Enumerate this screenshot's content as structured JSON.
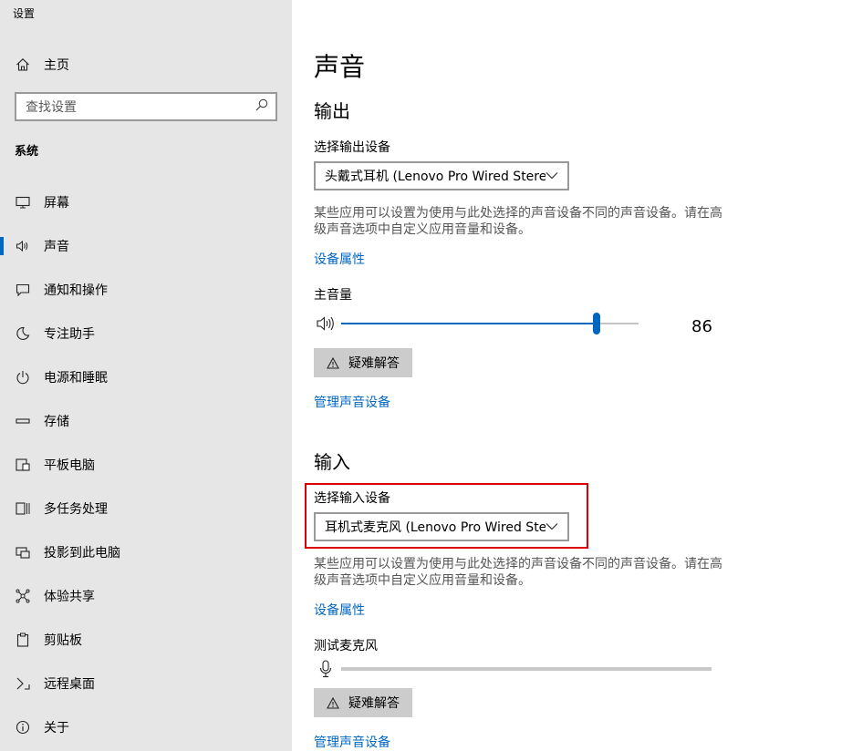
{
  "app": {
    "title": "设置"
  },
  "sidebar": {
    "home_label": "主页",
    "search_placeholder": "查找设置",
    "section": "系统",
    "items": [
      {
        "label": "屏幕",
        "icon": "display-icon"
      },
      {
        "label": "声音",
        "icon": "speaker-icon",
        "active": true
      },
      {
        "label": "通知和操作",
        "icon": "notification-icon"
      },
      {
        "label": "专注助手",
        "icon": "moon-icon"
      },
      {
        "label": "电源和睡眠",
        "icon": "power-icon"
      },
      {
        "label": "存储",
        "icon": "storage-icon"
      },
      {
        "label": "平板电脑",
        "icon": "tablet-icon"
      },
      {
        "label": "多任务处理",
        "icon": "multitask-icon"
      },
      {
        "label": "投影到此电脑",
        "icon": "project-icon"
      },
      {
        "label": "体验共享",
        "icon": "share-icon"
      },
      {
        "label": "剪贴板",
        "icon": "clipboard-icon"
      },
      {
        "label": "远程桌面",
        "icon": "remote-desktop-icon"
      },
      {
        "label": "关于",
        "icon": "info-icon"
      }
    ]
  },
  "main": {
    "title": "声音",
    "output": {
      "heading": "输出",
      "device_label": "选择输出设备",
      "device_value": "头戴式耳机 (Lenovo Pro Wired Stere...",
      "description": "某些应用可以设置为使用与此处选择的声音设备不同的声音设备。请在高级声音选项中自定义应用音量和设备。",
      "properties_link": "设备属性",
      "volume_label": "主音量",
      "volume_value": "86",
      "volume_level": 86,
      "troubleshoot": "疑难解答",
      "manage_link": "管理声音设备"
    },
    "input": {
      "heading": "输入",
      "device_label": "选择输入设备",
      "device_value": "耳机式麦克风 (Lenovo Pro Wired Ste...",
      "description": "某些应用可以设置为使用与此处选择的声音设备不同的声音设备。请在高级声音选项中自定义应用音量和设备。",
      "properties_link": "设备属性",
      "test_label": "测试麦克风",
      "mic_level": 0,
      "troubleshoot": "疑难解答",
      "manage_link": "管理声音设备"
    }
  },
  "colors": {
    "accent": "#0067c0",
    "sidebar_bg": "#e6e6e6",
    "highlight": "#dd0000"
  }
}
